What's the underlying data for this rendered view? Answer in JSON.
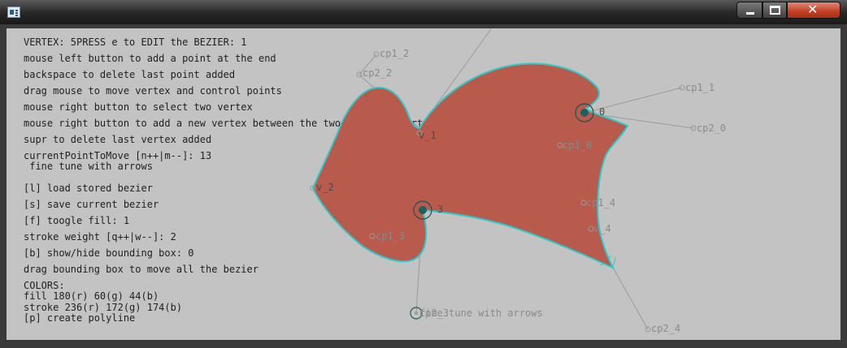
{
  "window": {
    "app_icon": "window-app-icon",
    "buttons": {
      "minimize": "minimize-icon",
      "maximize": "maximize-icon",
      "close": "close-icon"
    }
  },
  "instructions": [
    "VERTEX: 5PRESS e to EDIT the BEZIER: 1",
    "mouse left button to add a point at the end",
    "backspace to delete last point added",
    "drag mouse to move vertex and control points",
    "mouse right button to select two vertex",
    "mouse right button to add a new vertex between the two selected vertex",
    "supr to delete last vertex added",
    "currentPointToMove [n++|m--]: 13",
    " fine tune with arrows",
    "[l] load stored bezier",
    "[s] save current bezier",
    "[f] toogle fill: 1",
    "stroke weight [q++|w--]: 2",
    "[b] show/hide bounding box: 0",
    "drag bounding box to move all the bezier",
    "COLORS:",
    "fill 180(r) 60(g) 44(b)",
    "stroke 236(r) 172(g) 174(b)",
    "[p] create polyline"
  ],
  "labels": {
    "cp1_2": "cp1_2",
    "cp2_2": "cp2_2",
    "cp1_1": "cp1_1",
    "cp2_0": "cp2_0",
    "v_1": "v_1",
    "v_0": "0",
    "v_2": "v_2",
    "v_3": "3",
    "cp1_0": "cp1_0",
    "cp1_4": "cp1_4",
    "v_4": "v_4",
    "cp1_3": "cp1_3",
    "cp2_3": "cp2_3",
    "fine_tune": "fine tune with arrows",
    "cp2_4": "cp2_4"
  },
  "colors": {
    "canvas": "#c3c3c3",
    "fill": "#b85a4c",
    "stroke": "#2ec8c8",
    "normals": "#2ec8c8",
    "handle": "#9a9a9a",
    "vertex": "#1f5f5c",
    "text": "#1f1f1f"
  }
}
